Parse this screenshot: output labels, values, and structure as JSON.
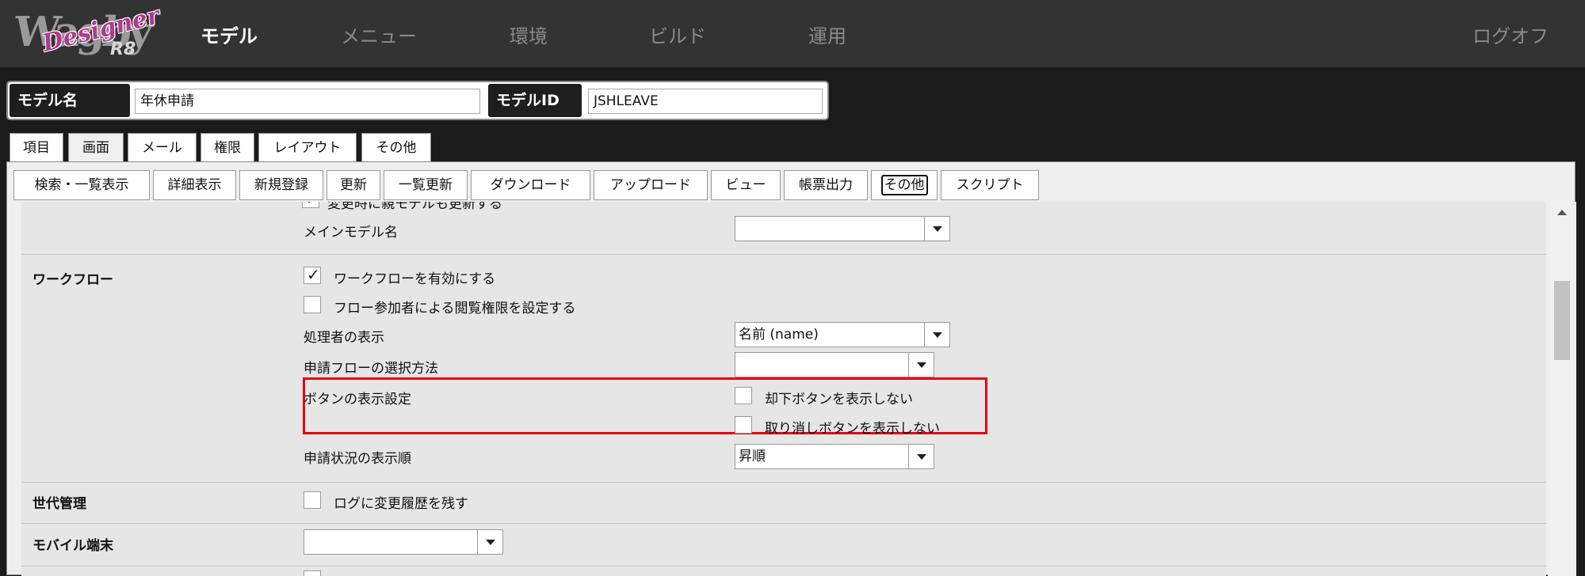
{
  "header": {
    "logo": {
      "word": "Wagby",
      "script": "Designer",
      "version": "R8"
    },
    "nav": [
      "モデル",
      "メニュー",
      "環境",
      "ビルド",
      "運用"
    ],
    "logout": "ログオフ"
  },
  "model": {
    "name_label": "モデル名",
    "name_value": "年休申請",
    "id_label": "モデルID",
    "id_value": "JSHLEAVE"
  },
  "tabs": [
    "項目",
    "画面",
    "メール",
    "権限",
    "レイアウト",
    "その他"
  ],
  "subtabs": [
    "検索・一覧表示",
    "詳細表示",
    "新規登録",
    "更新",
    "一覧更新",
    "ダウンロード",
    "アップロード",
    "ビュー",
    "帳票出力",
    "その他",
    "スクリプト"
  ],
  "form": {
    "top_partial": "変更時に親モデルも更新する",
    "main_model_label": "メインモデル名",
    "main_model_value": "",
    "workflow": {
      "section": "ワークフロー",
      "enable": "ワークフローを有効にする",
      "access": "フロー参加者による閲覧権限を設定する",
      "handler_label": "処理者の表示",
      "handler_value": "名前 (name)",
      "flow_select_label": "申請フローの選択方法",
      "flow_select_value": "",
      "button_label": "ボタンの表示設定",
      "hide_reject": "却下ボタンを表示しない",
      "hide_cancel": "取り消しボタンを表示しない",
      "order_label": "申請状況の表示順",
      "order_value": "昇順"
    },
    "history": {
      "section": "世代管理",
      "keep": "ログに変更履歴を残す"
    },
    "mobile": {
      "section": "モバイル端末",
      "value": ""
    }
  },
  "checks": {
    "parent_update": true,
    "workflow_enable": true,
    "access": false,
    "hide_reject": false,
    "hide_cancel": false,
    "history": false
  },
  "colors": {
    "highlight": "#e60012",
    "topbar": "#333333"
  }
}
